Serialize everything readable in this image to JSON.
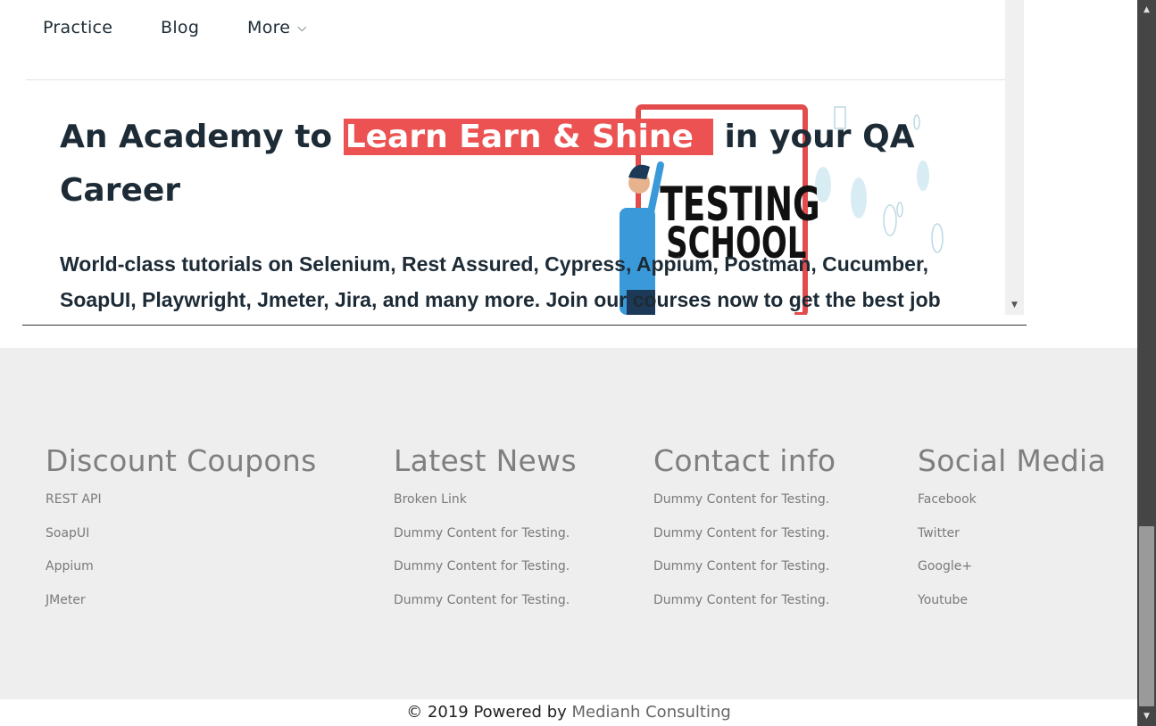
{
  "nav": {
    "items": [
      "Practice",
      "Blog",
      "More"
    ],
    "more_chevron": "chevron-down-icon"
  },
  "hero": {
    "title_prefix": "An Academy to ",
    "title_highlight": "Learn Earn & Shine",
    "title_suffix": " in your QA Career",
    "description": "World-class tutorials on Selenium, Rest Assured, Cypress, Appium, Postman, Cucumber, SoapUI, Playwright, Jmeter, Jira, and many more. Join our courses now to get the best job",
    "illustration_text_1": "TESTING",
    "illustration_text_2": "SCHOOL",
    "highlight_color": "#ec5252"
  },
  "footer": {
    "columns": [
      {
        "title": "Discount Coupons",
        "links": [
          "REST API",
          "SoapUI",
          "Appium",
          "JMeter"
        ]
      },
      {
        "title": "Latest News",
        "links": [
          "Broken Link",
          "Dummy Content for Testing.",
          "Dummy Content for Testing.",
          "Dummy Content for Testing."
        ]
      },
      {
        "title": "Contact info",
        "links": [
          "Dummy Content for Testing.",
          "Dummy Content for Testing.",
          "Dummy Content for Testing.",
          "Dummy Content for Testing."
        ]
      },
      {
        "title": "Social Media",
        "links": [
          "Facebook",
          "Twitter",
          "Google+",
          "Youtube"
        ]
      }
    ],
    "copyright_prefix": "© 2019 Powered by ",
    "copyright_brand": "Medianh Consulting"
  }
}
